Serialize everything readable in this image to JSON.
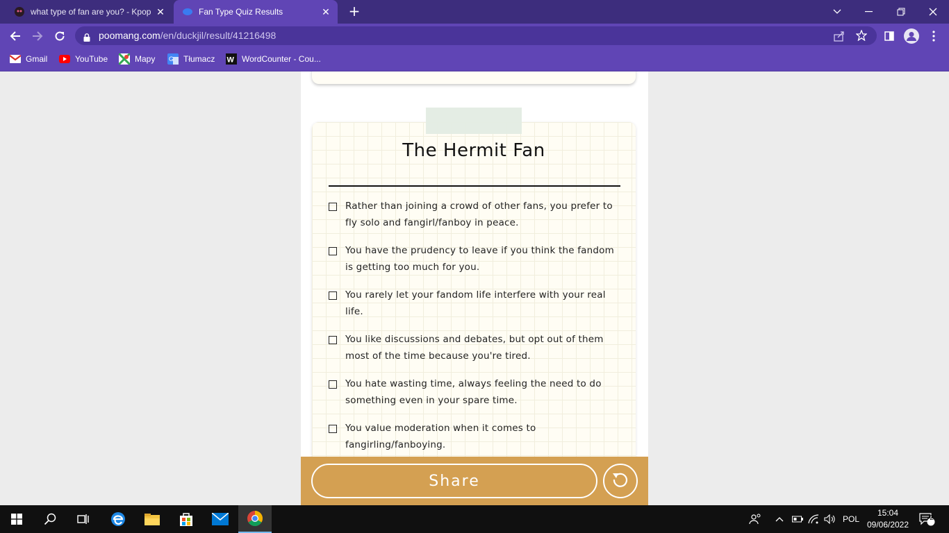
{
  "browser": {
    "tabs": [
      {
        "title": "what type of fan are you? - Kpop",
        "active": false
      },
      {
        "title": "Fan Type Quiz Results",
        "active": true
      }
    ],
    "url_host": "poomang.com",
    "url_path": "/en/duckjil/result/41216498",
    "bookmarks": [
      "Gmail",
      "YouTube",
      "Mapy",
      "Tłumacz",
      "WordCounter - Cou..."
    ],
    "colors": {
      "tabbar": "#3d2d7d",
      "toolbar": "#6045b5"
    }
  },
  "result": {
    "title": "The Hermit Fan",
    "traits": [
      "Rather than joining a crowd of other fans, you prefer to fly solo and fangirl/fanboy in peace.",
      "You have the prudency to leave if you think the fandom is getting too much for you.",
      "You rarely let your fandom life interfere with your real life.",
      "You like discussions and debates, but opt out of them most of the time because you're tired.",
      "You hate wasting time, always feeling the need to do something even in your spare time.",
      "You value moderation when it comes to fangirling/fanboying."
    ]
  },
  "actions": {
    "share_label": "Share",
    "retry_icon": "retry-icon",
    "accent": "#d4a052"
  },
  "taskbar": {
    "language": "POL",
    "time": "15:04",
    "date": "09/06/2022",
    "notification_count": "2"
  }
}
